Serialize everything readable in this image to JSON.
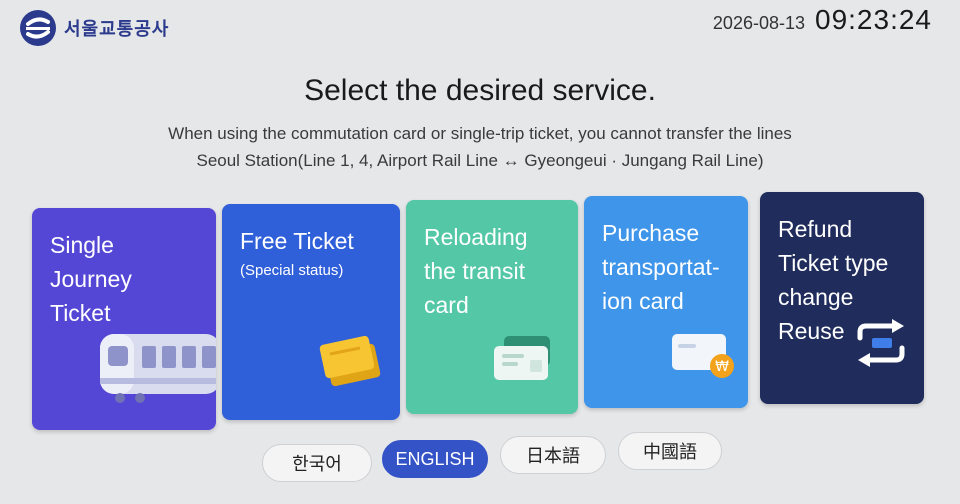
{
  "header": {
    "org_name": "서울교통공사",
    "date": "2026-08-13",
    "time": "09:23:24"
  },
  "main": {
    "title": "Select the desired service.",
    "notice_line1": "When using the commutation card or single-trip ticket, you cannot transfer the lines",
    "notice_line2": "Seoul Station(Line 1, 4, Airport Rail Line ↔ Gyeongeui · Jungang Rail Line)"
  },
  "services": [
    {
      "label": "Single\nJourney\nTicket",
      "sub": "",
      "color": "#5447d6",
      "icon": "subway-train-icon"
    },
    {
      "label": "Free Ticket",
      "sub": "(Special status)",
      "color": "#2f5fd9",
      "icon": "ticket-cards-icon"
    },
    {
      "label": "Reloading\nthe transit\ncard",
      "sub": "",
      "color": "#54c8a6",
      "icon": "transit-card-icon"
    },
    {
      "label": "Purchase\ntransportat-\nion card",
      "sub": "",
      "color": "#3e95ea",
      "icon": "card-purchase-icon"
    },
    {
      "label": "Refund\nTicket type\nchange\nReuse",
      "sub": "",
      "color": "#1f2c5c",
      "icon": "exchange-arrows-icon"
    }
  ],
  "languages": [
    {
      "label": "한국어",
      "active": false
    },
    {
      "label": "ENGLISH",
      "active": true
    },
    {
      "label": "日本語",
      "active": false
    },
    {
      "label": "中國語",
      "active": false
    }
  ]
}
